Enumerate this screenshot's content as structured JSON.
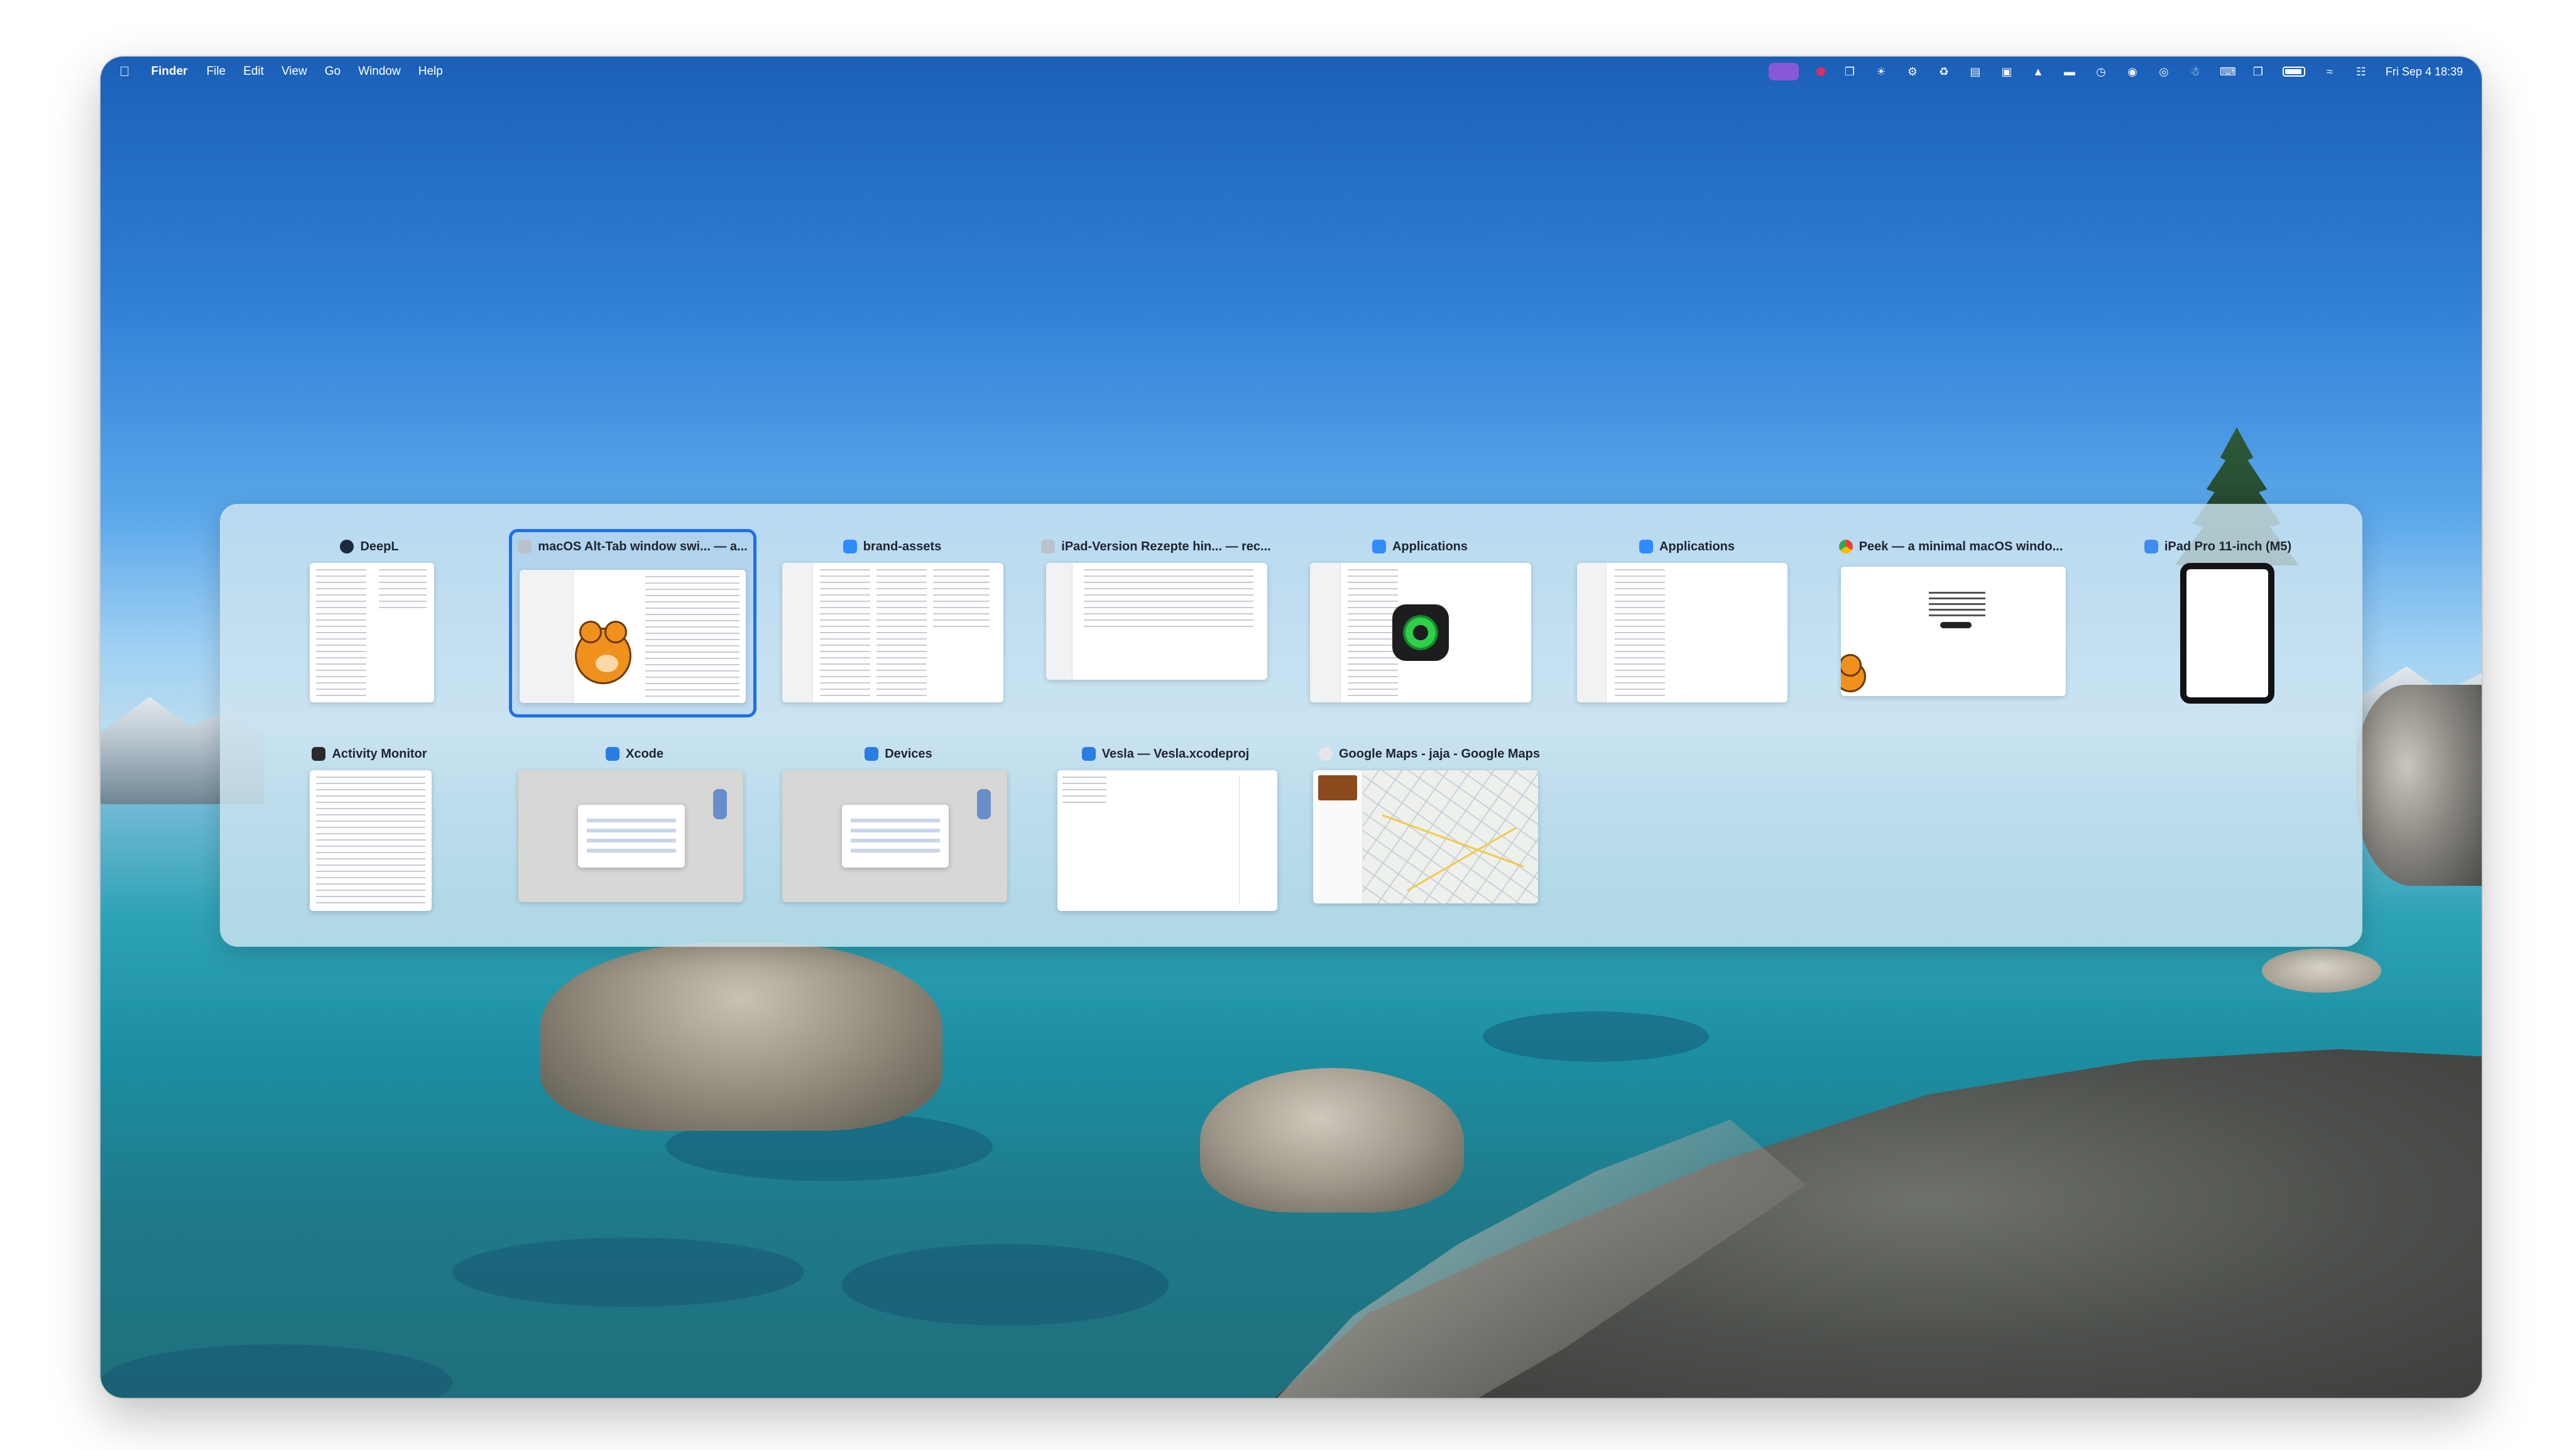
{
  "menubar": {
    "app_name": "Finder",
    "menus": [
      "File",
      "Edit",
      "View",
      "Go",
      "Window",
      "Help"
    ],
    "clock": "Fri Sep 4  18:39"
  },
  "switcher": {
    "windows": [
      {
        "title": "DeepL",
        "icon": "deepl-icon",
        "icon_color": "#1b2a3d"
      },
      {
        "title": "macOS Alt-Tab window swi... — a...",
        "icon": "peek-icon",
        "icon_color": "#b9c2cc",
        "selected": true
      },
      {
        "title": "brand-assets",
        "icon": "finder-icon",
        "icon_color": "#2f8bff"
      },
      {
        "title": "iPad-Version Rezepte hin... — rec...",
        "icon": "peek-icon",
        "icon_color": "#b9c2cc"
      },
      {
        "title": "Applications",
        "icon": "finder-icon",
        "icon_color": "#2f8bff"
      },
      {
        "title": "Applications",
        "icon": "finder-icon",
        "icon_color": "#2f8bff"
      },
      {
        "title": "Peek — a minimal macOS windo...",
        "icon": "chrome-icon",
        "icon_color": "#e94235"
      },
      {
        "title": "iPad Pro 11-inch (M5)",
        "icon": "simulator-icon",
        "icon_color": "#3f8cf0"
      },
      {
        "title": "Activity Monitor",
        "icon": "activity-monitor-icon",
        "icon_color": "#2a2a2a"
      },
      {
        "title": "Xcode",
        "icon": "xcode-icon",
        "icon_color": "#2a7de1"
      },
      {
        "title": "Devices",
        "icon": "xcode-icon",
        "icon_color": "#2a7de1"
      },
      {
        "title": "Vesla — Vesla.xcodeproj",
        "icon": "xcode-icon",
        "icon_color": "#2a7de1"
      },
      {
        "title": "Google Maps - jaja - Google Maps",
        "icon": "chrome-app-icon",
        "icon_color": "#e6e6e6"
      }
    ]
  },
  "colors": {
    "selection": "#1f6fe5",
    "recording_indicator": "#e62a5b",
    "menubar_pill": "#8f57d9"
  }
}
